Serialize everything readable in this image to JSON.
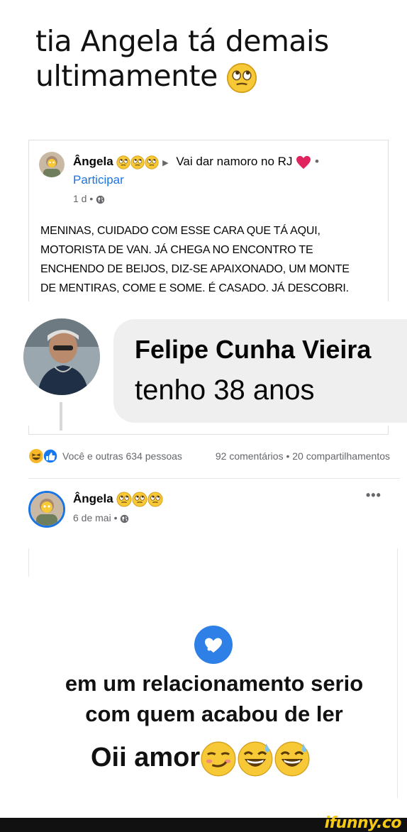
{
  "meme": {
    "title_line1": "tia Angela tá demais",
    "title_line2": "ultimamente"
  },
  "post1": {
    "author": "Ângela",
    "group": "Vai dar namoro no RJ",
    "separator": "•",
    "join": "Participar",
    "time": "1 d •",
    "body": "MENINAS, CUIDADO COM ESSE CARA QUE TÁ AQUI, MOTORISTA DE VAN. JÁ CHEGA NO ENCONTRO TE ENCHENDO DE BEIJOS, DIZ-SE APAIXONADO, UM MONTE DE MENTIRAS, COME E SOME. É CASADO. JÁ DESCOBRI."
  },
  "screenshot": {
    "name": "Felipe Cunha Vieira",
    "text": "tenho 38 anos"
  },
  "reactions": {
    "who": "Você e outras 634 pessoas",
    "stats": "92 comentários • 20 compartilhamentos"
  },
  "post2": {
    "author": "Ângela",
    "time": "6 de mai •",
    "more": "•••",
    "card_line1": "em um relacionamento serio",
    "card_line2": "com quem acabou de ler",
    "card_line3": "Oii amor"
  },
  "watermark": "ifunny.co",
  "colors": {
    "link_blue": "#1b74e4",
    "heart_red": "#e0245e",
    "badge_blue": "#2f80e6",
    "watermark_yellow": "#f6c915"
  },
  "icons": [
    "rolling-eyes-emoji",
    "heart-emoji",
    "globe-icon",
    "haha-reaction-icon",
    "like-reaction-icon",
    "smirk-emoji",
    "grinning-sweat-emoji",
    "heart-badge-icon",
    "more-options-icon"
  ]
}
